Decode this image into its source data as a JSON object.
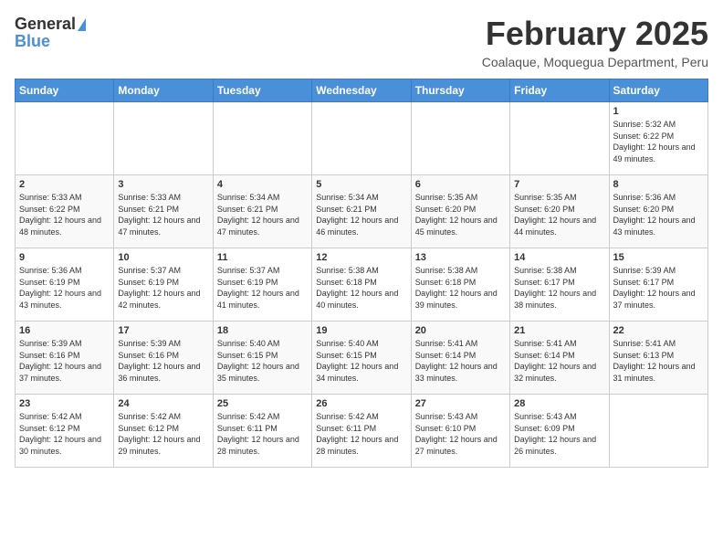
{
  "header": {
    "logo_general": "General",
    "logo_blue": "Blue",
    "title": "February 2025",
    "subtitle": "Coalaque, Moquegua Department, Peru"
  },
  "weekdays": [
    "Sunday",
    "Monday",
    "Tuesday",
    "Wednesday",
    "Thursday",
    "Friday",
    "Saturday"
  ],
  "weeks": [
    [
      {
        "day": "",
        "info": ""
      },
      {
        "day": "",
        "info": ""
      },
      {
        "day": "",
        "info": ""
      },
      {
        "day": "",
        "info": ""
      },
      {
        "day": "",
        "info": ""
      },
      {
        "day": "",
        "info": ""
      },
      {
        "day": "1",
        "info": "Sunrise: 5:32 AM\nSunset: 6:22 PM\nDaylight: 12 hours and 49 minutes."
      }
    ],
    [
      {
        "day": "2",
        "info": "Sunrise: 5:33 AM\nSunset: 6:22 PM\nDaylight: 12 hours and 48 minutes."
      },
      {
        "day": "3",
        "info": "Sunrise: 5:33 AM\nSunset: 6:21 PM\nDaylight: 12 hours and 47 minutes."
      },
      {
        "day": "4",
        "info": "Sunrise: 5:34 AM\nSunset: 6:21 PM\nDaylight: 12 hours and 47 minutes."
      },
      {
        "day": "5",
        "info": "Sunrise: 5:34 AM\nSunset: 6:21 PM\nDaylight: 12 hours and 46 minutes."
      },
      {
        "day": "6",
        "info": "Sunrise: 5:35 AM\nSunset: 6:20 PM\nDaylight: 12 hours and 45 minutes."
      },
      {
        "day": "7",
        "info": "Sunrise: 5:35 AM\nSunset: 6:20 PM\nDaylight: 12 hours and 44 minutes."
      },
      {
        "day": "8",
        "info": "Sunrise: 5:36 AM\nSunset: 6:20 PM\nDaylight: 12 hours and 43 minutes."
      }
    ],
    [
      {
        "day": "9",
        "info": "Sunrise: 5:36 AM\nSunset: 6:19 PM\nDaylight: 12 hours and 43 minutes."
      },
      {
        "day": "10",
        "info": "Sunrise: 5:37 AM\nSunset: 6:19 PM\nDaylight: 12 hours and 42 minutes."
      },
      {
        "day": "11",
        "info": "Sunrise: 5:37 AM\nSunset: 6:19 PM\nDaylight: 12 hours and 41 minutes."
      },
      {
        "day": "12",
        "info": "Sunrise: 5:38 AM\nSunset: 6:18 PM\nDaylight: 12 hours and 40 minutes."
      },
      {
        "day": "13",
        "info": "Sunrise: 5:38 AM\nSunset: 6:18 PM\nDaylight: 12 hours and 39 minutes."
      },
      {
        "day": "14",
        "info": "Sunrise: 5:38 AM\nSunset: 6:17 PM\nDaylight: 12 hours and 38 minutes."
      },
      {
        "day": "15",
        "info": "Sunrise: 5:39 AM\nSunset: 6:17 PM\nDaylight: 12 hours and 37 minutes."
      }
    ],
    [
      {
        "day": "16",
        "info": "Sunrise: 5:39 AM\nSunset: 6:16 PM\nDaylight: 12 hours and 37 minutes."
      },
      {
        "day": "17",
        "info": "Sunrise: 5:39 AM\nSunset: 6:16 PM\nDaylight: 12 hours and 36 minutes."
      },
      {
        "day": "18",
        "info": "Sunrise: 5:40 AM\nSunset: 6:15 PM\nDaylight: 12 hours and 35 minutes."
      },
      {
        "day": "19",
        "info": "Sunrise: 5:40 AM\nSunset: 6:15 PM\nDaylight: 12 hours and 34 minutes."
      },
      {
        "day": "20",
        "info": "Sunrise: 5:41 AM\nSunset: 6:14 PM\nDaylight: 12 hours and 33 minutes."
      },
      {
        "day": "21",
        "info": "Sunrise: 5:41 AM\nSunset: 6:14 PM\nDaylight: 12 hours and 32 minutes."
      },
      {
        "day": "22",
        "info": "Sunrise: 5:41 AM\nSunset: 6:13 PM\nDaylight: 12 hours and 31 minutes."
      }
    ],
    [
      {
        "day": "23",
        "info": "Sunrise: 5:42 AM\nSunset: 6:12 PM\nDaylight: 12 hours and 30 minutes."
      },
      {
        "day": "24",
        "info": "Sunrise: 5:42 AM\nSunset: 6:12 PM\nDaylight: 12 hours and 29 minutes."
      },
      {
        "day": "25",
        "info": "Sunrise: 5:42 AM\nSunset: 6:11 PM\nDaylight: 12 hours and 28 minutes."
      },
      {
        "day": "26",
        "info": "Sunrise: 5:42 AM\nSunset: 6:11 PM\nDaylight: 12 hours and 28 minutes."
      },
      {
        "day": "27",
        "info": "Sunrise: 5:43 AM\nSunset: 6:10 PM\nDaylight: 12 hours and 27 minutes."
      },
      {
        "day": "28",
        "info": "Sunrise: 5:43 AM\nSunset: 6:09 PM\nDaylight: 12 hours and 26 minutes."
      },
      {
        "day": "",
        "info": ""
      }
    ]
  ]
}
